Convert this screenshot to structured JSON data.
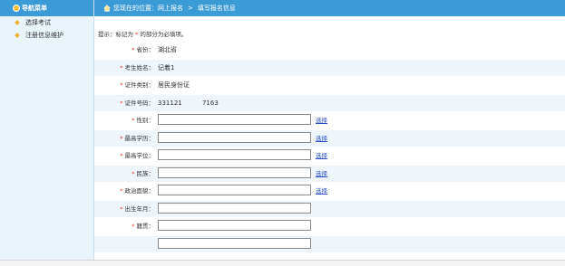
{
  "sidebar": {
    "title": "导航菜单",
    "items": [
      {
        "label": "选择考试"
      },
      {
        "label": "注册信息维护"
      }
    ]
  },
  "breadcrumb": {
    "prefix": "您现在的位置：网上报名",
    "separator": ">",
    "current": "填写报名信息"
  },
  "tip": {
    "text_before": "提示：标记为",
    "star": "*",
    "text_after": "的部分为必填项。"
  },
  "form": {
    "rows": [
      {
        "label": "省份：",
        "required": true,
        "value": "湖北省"
      },
      {
        "label": "考生姓名：",
        "required": true,
        "value": "记着1"
      },
      {
        "label": "证件类别：",
        "required": true,
        "value": "居民身份证"
      },
      {
        "label": "证件号码：",
        "required": true,
        "value": "331121          7163"
      },
      {
        "label": "性别：",
        "required": true,
        "select_link": "选择"
      },
      {
        "label": "最高学历：",
        "required": true,
        "select_link": "选择"
      },
      {
        "label": "最高学位：",
        "required": true,
        "select_link": "选择"
      },
      {
        "label": "民族：",
        "required": true,
        "select_link": "选择"
      },
      {
        "label": "政治面貌：",
        "required": true,
        "select_link": "选择"
      },
      {
        "label": "出生年月：",
        "required": true
      },
      {
        "label": "籍贯：",
        "required": true
      },
      {
        "label": "",
        "required": false
      }
    ]
  },
  "colors": {
    "header_blue": "#3a9bd6",
    "required_red": "#e23a2a",
    "link_blue": "#2a4fc6"
  }
}
